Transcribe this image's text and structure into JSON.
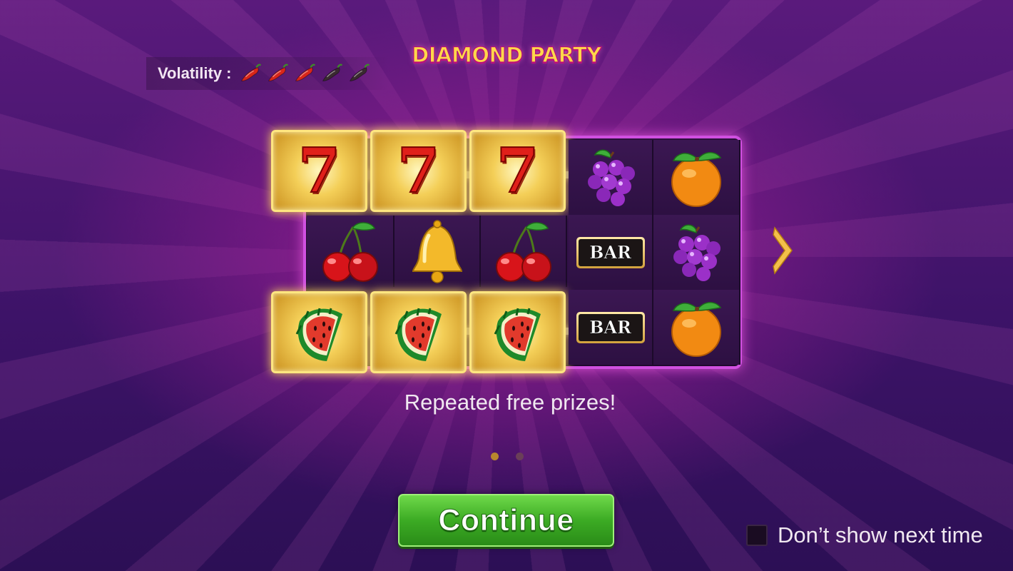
{
  "game": {
    "title": "DIAMOND PARTY"
  },
  "volatility": {
    "label": "Volatility :",
    "level": 3,
    "max": 5
  },
  "reels": {
    "rows": [
      [
        "seven",
        "seven",
        "seven",
        "grapes",
        "orange"
      ],
      [
        "cherry",
        "bell",
        "cherry",
        "bar",
        "grapes"
      ],
      [
        "watermelon",
        "watermelon",
        "watermelon",
        "bar",
        "orange"
      ]
    ],
    "winning_rows": [
      1,
      3
    ],
    "seven_text": "7",
    "bar_text": "BAR"
  },
  "caption": "Repeated free prizes!",
  "pagination": {
    "current": 1,
    "total": 2
  },
  "continue_label": "Continue",
  "dont_show_label": "Don’t show next time",
  "colors": {
    "button_green": "#3cab24",
    "frame_pink": "#d050e0",
    "title_yellow": "#ffd84a"
  }
}
